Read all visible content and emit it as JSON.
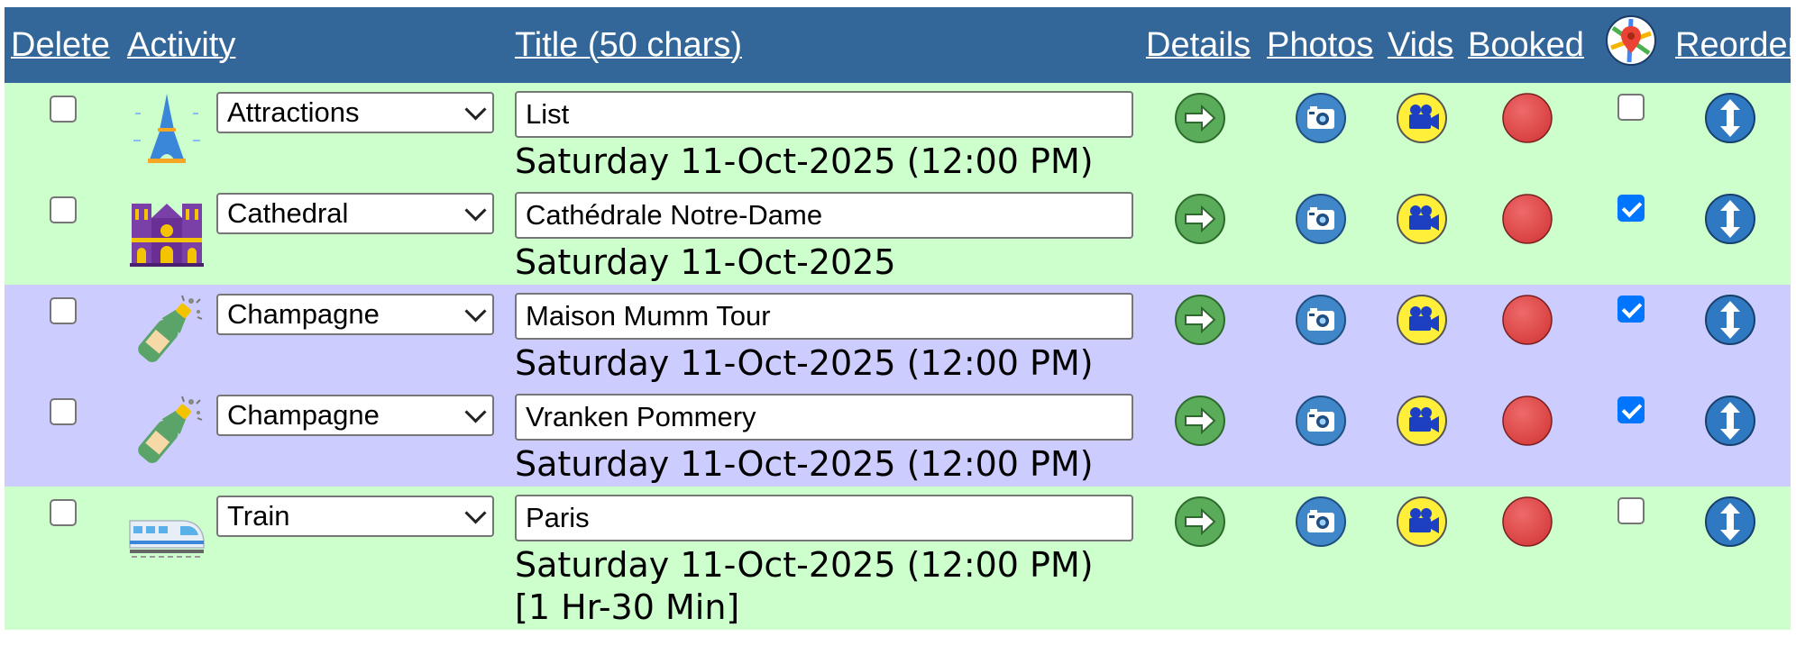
{
  "header": {
    "delete": "Delete",
    "activity": "Activity",
    "title": "Title (50 chars)",
    "details": "Details",
    "photos": "Photos",
    "vids": "Vids",
    "booked": "Booked",
    "map_icon": "map-pin-icon",
    "reorder": "Reorder"
  },
  "colors": {
    "header_bg": "#336699",
    "row_green": "#ccffcc",
    "row_purple": "#ccccff",
    "details_green": "#5aab5a",
    "photo_blue": "#3f87c8",
    "video_yellow": "#ffef3a",
    "booked_red": "#e04545",
    "reorder_blue": "#2f79c2",
    "checkbox_blue": "#0075ff"
  },
  "rows": [
    {
      "icon": "eiffel-tower-icon",
      "activity": "Attractions",
      "title": "List",
      "date": "Saturday 11-Oct-2025 (12:00 PM)",
      "duration": "",
      "map_checked": false,
      "bg": "green"
    },
    {
      "icon": "cathedral-icon",
      "activity": "Cathedral",
      "title": "Cathédrale Notre-Dame",
      "date": "Saturday 11-Oct-2025",
      "duration": "",
      "map_checked": true,
      "bg": "green"
    },
    {
      "icon": "champagne-bottle-icon",
      "activity": "Champagne",
      "title": "Maison Mumm Tour",
      "date": "Saturday 11-Oct-2025 (12:00 PM)",
      "duration": "",
      "map_checked": true,
      "bg": "purple"
    },
    {
      "icon": "champagne-bottle-icon",
      "activity": "Champagne",
      "title": "Vranken Pommery",
      "date": "Saturday 11-Oct-2025 (12:00 PM)",
      "duration": "",
      "map_checked": true,
      "bg": "purple"
    },
    {
      "icon": "train-icon",
      "activity": "Train",
      "title": "Paris",
      "date": "Saturday 11-Oct-2025 (12:00 PM)",
      "duration": "[1 Hr-30 Min]",
      "map_checked": false,
      "bg": "green"
    }
  ]
}
